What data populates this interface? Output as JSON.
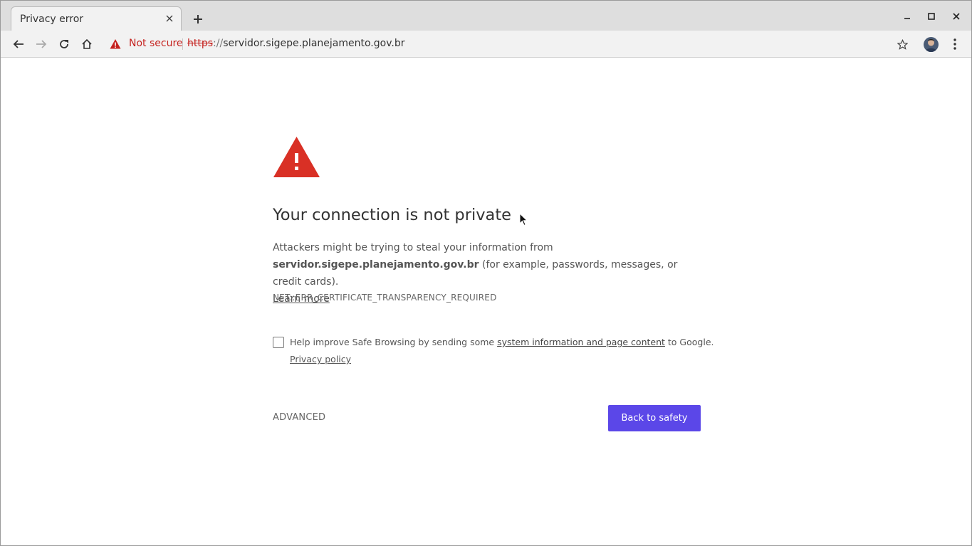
{
  "tab": {
    "title": "Privacy error"
  },
  "omnibox": {
    "security_label": "Not secure",
    "url_scheme": "https",
    "url_separator": "://",
    "url_host": "servidor.sigepe.planejamento.gov.br"
  },
  "interstitial": {
    "heading": "Your connection is not private",
    "explanation_prefix": "Attackers might be trying to steal your information from",
    "host": "servidor.sigepe.planejamento.gov.br",
    "explanation_suffix": "(for example, passwords, messages, or credit cards).",
    "learn_more": "Learn more",
    "error_code": "NET::ERR_CERTIFICATE_TRANSPARENCY_REQUIRED",
    "safe_browsing": {
      "text_prefix": "Help improve Safe Browsing by sending some",
      "link": "system information and page content",
      "text_suffix": "to Google.",
      "privacy_policy": "Privacy policy",
      "checked": false
    },
    "advanced_label": "ADVANCED",
    "primary_button": "Back to safety"
  },
  "colors": {
    "accent_button": "#5b47e8",
    "warning_red": "#c5221f"
  }
}
